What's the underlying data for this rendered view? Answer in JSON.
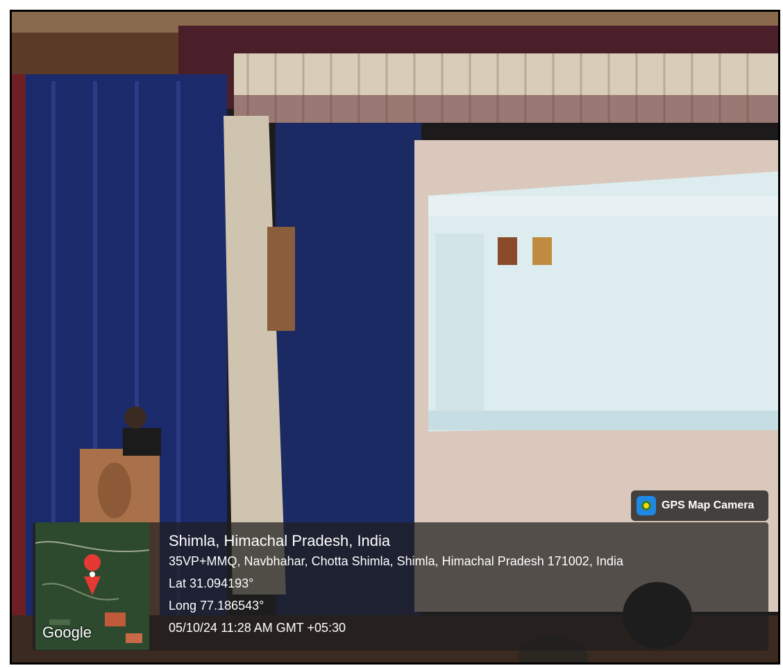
{
  "badge": {
    "icon": "gps-map-camera-icon",
    "label": "GPS Map Camera"
  },
  "map": {
    "provider": "Google",
    "pin": "location-pin-icon"
  },
  "location": {
    "title": "Shimla, Himachal Pradesh, India",
    "address": "35VP+MMQ, Navbhahar, Chotta Shimla, Shimla, Himachal Pradesh 171002, India",
    "lat": "Lat 31.094193°",
    "long": "Long 77.186543°",
    "datetime": "05/10/24 11:28 AM GMT +05:30"
  },
  "colors": {
    "pin": "#e53935",
    "stage_curtain": "#1a2a66",
    "valance": "#4a1f2a"
  }
}
